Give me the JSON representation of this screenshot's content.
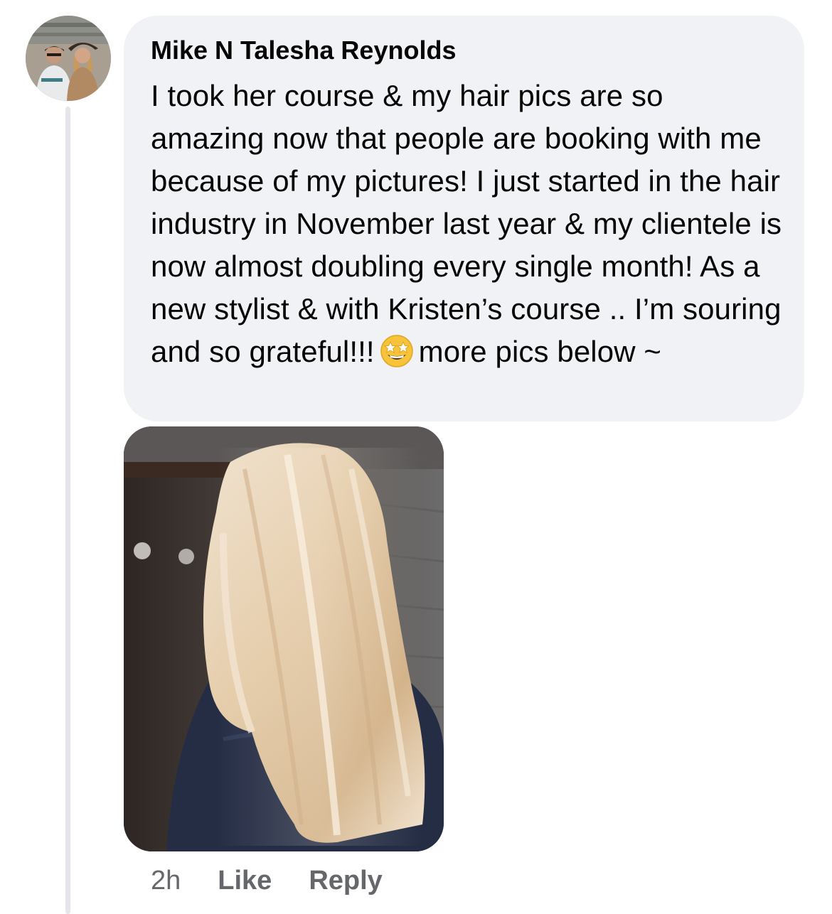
{
  "comment": {
    "author": "Mike N Talesha Reynolds",
    "text_before_emoji": "I took her course & my hair pics are so amazing now that people are booking with me because of my pictures! I just started in the hair industry in November last year & my clientele is now almost doubling every single month! As a new stylist & with Kristen’s course .. I’m souring and so grateful!!!",
    "emoji": "star-struck",
    "text_after_emoji": "more pics below ~",
    "timestamp": "2h",
    "like_label": "Like",
    "reply_label": "Reply"
  },
  "icons": {
    "avatar": "profile-photo",
    "photo": "hair-photo"
  },
  "colors": {
    "bubble_bg": "#f0f2f5",
    "secondary_text": "#65676b",
    "thread_line": "#e4e6eb"
  }
}
